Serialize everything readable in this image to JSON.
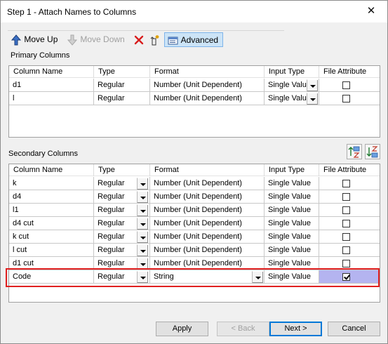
{
  "window": {
    "title": "Step 1 - Attach Names to Columns",
    "close_glyph": "✕"
  },
  "toolbar": {
    "move_up": "Move Up",
    "move_down": "Move Down",
    "delete_icon": "delete-icon",
    "new_icon": "new-column-icon",
    "advanced": "Advanced"
  },
  "primary": {
    "label": "Primary Columns",
    "headers": [
      "Column Name",
      "Type",
      "Format",
      "Input Type",
      "File Attribute"
    ],
    "rows": [
      {
        "name": "d1",
        "type": "Regular",
        "format": "Number (Unit Dependent)",
        "input": "Single Value",
        "attr": false
      },
      {
        "name": "l",
        "type": "Regular",
        "format": "Number (Unit Dependent)",
        "input": "Single Value",
        "attr": false
      }
    ]
  },
  "secondary": {
    "label": "Secondary Columns",
    "headers": [
      "Column Name",
      "Type",
      "Format",
      "Input Type",
      "File Attribute"
    ],
    "rows": [
      {
        "name": "k",
        "type": "Regular",
        "format": "Number (Unit Dependent)",
        "input": "Single Value",
        "attr": false
      },
      {
        "name": "d4",
        "type": "Regular",
        "format": "Number (Unit Dependent)",
        "input": "Single Value",
        "attr": false
      },
      {
        "name": "l1",
        "type": "Regular",
        "format": "Number (Unit Dependent)",
        "input": "Single Value",
        "attr": false
      },
      {
        "name": "d4 cut",
        "type": "Regular",
        "format": "Number (Unit Dependent)",
        "input": "Single Value",
        "attr": false
      },
      {
        "name": "k cut",
        "type": "Regular",
        "format": "Number (Unit Dependent)",
        "input": "Single Value",
        "attr": false
      },
      {
        "name": "l cut",
        "type": "Regular",
        "format": "Number (Unit Dependent)",
        "input": "Single Value",
        "attr": false
      },
      {
        "name": "d1 cut",
        "type": "Regular",
        "format": "Number (Unit Dependent)",
        "input": "Single Value",
        "attr": false
      },
      {
        "name": "Code",
        "type": "Regular",
        "format": "String",
        "input": "Single Value",
        "attr": true
      }
    ]
  },
  "buttons": {
    "apply": "Apply",
    "back": "< Back",
    "next": "Next >",
    "cancel": "Cancel"
  },
  "colors": {
    "selection": "#b4b4f0",
    "highlight": "#e02020",
    "default_button": "#0078d7"
  }
}
